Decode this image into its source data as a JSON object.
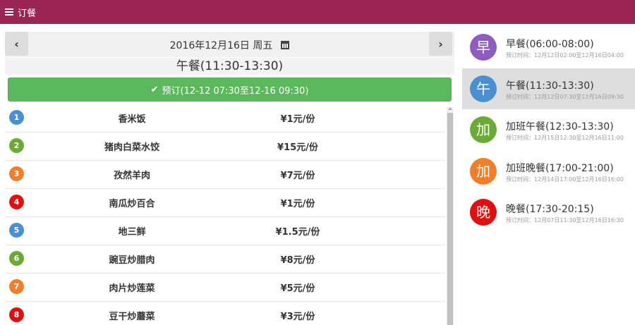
{
  "app": {
    "title": "订餐"
  },
  "date": {
    "label": "2016年12月16日 周五",
    "prev_icon": "chevron-left-icon",
    "next_icon": "chevron-right-icon",
    "calendar_icon": "calendar-icon"
  },
  "meal_title": "午餐(11:30-13:30)",
  "order_button": {
    "label": "预订(12-12 07:30至12-16 09:30)",
    "icon": "check-icon",
    "color": "#5cb85c"
  },
  "dishes": [
    {
      "num": "1",
      "name": "香米饭",
      "price": "¥1元/份",
      "color": "#4a8fd1"
    },
    {
      "num": "2",
      "name": "猪肉白菜水饺",
      "price": "¥15元/份",
      "color": "#6aaa35"
    },
    {
      "num": "3",
      "name": "孜然羊肉",
      "price": "¥7元/份",
      "color": "#f07e2b"
    },
    {
      "num": "4",
      "name": "南瓜炒百合",
      "price": "¥1元/份",
      "color": "#e01010"
    },
    {
      "num": "5",
      "name": "地三鲜",
      "price": "¥1.5元/份",
      "color": "#4a8fd1"
    },
    {
      "num": "6",
      "name": "豌豆炒腊肉",
      "price": "¥8元/份",
      "color": "#6aaa35"
    },
    {
      "num": "7",
      "name": "肉片炒莲菜",
      "price": "¥5元/份",
      "color": "#f07e2b"
    },
    {
      "num": "8",
      "name": "豆干炒蘑菜",
      "price": "¥3元/份",
      "color": "#e01010"
    }
  ],
  "meals": [
    {
      "char": "早",
      "name": "早餐(06:00-08:00)",
      "time": "预订时间：12月12日02:00至12月16日04:00",
      "color": "#8e5bbf",
      "active": false
    },
    {
      "char": "午",
      "name": "午餐(11:30-13:30)",
      "time": "预订时间：12月12日07:30至12月16日09:30",
      "color": "#4a8fd1",
      "active": true
    },
    {
      "char": "加",
      "name": "加班午餐(12:30-13:30)",
      "time": "预订时间：12月15日12:30至12月16日11:00",
      "color": "#6aaa35",
      "active": false
    },
    {
      "char": "加",
      "name": "加班晚餐(17:00-21:00)",
      "time": "预订时间：12月14日17:00至12月16日16:00",
      "color": "#f07e2b",
      "active": false
    },
    {
      "char": "晚",
      "name": "晚餐(17:30-20:15)",
      "time": "预订时间：12月07日11:30至12月16日16:30",
      "color": "#e01010",
      "active": false
    }
  ],
  "colors": {
    "topbar": "#9b2554",
    "active_meal_bg": "#dedede"
  }
}
